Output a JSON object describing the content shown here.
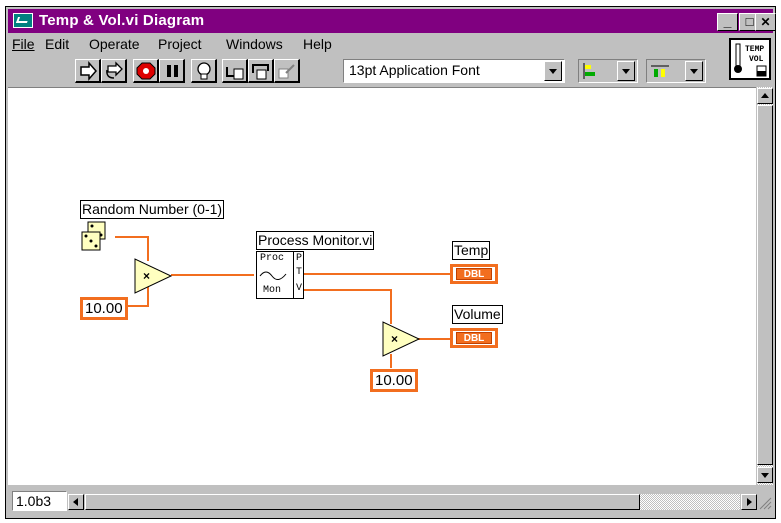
{
  "window": {
    "title": "Temp & Vol.vi Diagram",
    "controls": {
      "minimize": "_",
      "maximize": "□",
      "close": "✕"
    }
  },
  "menu": [
    "File",
    "Edit",
    "Operate",
    "Project",
    "Windows",
    "Help"
  ],
  "toolbar": {
    "buttons": [
      "run-arrow-icon",
      "run-continuous-icon",
      "abort-icon",
      "pause-icon",
      "highlight-execution-icon",
      "step-into-icon",
      "step-over-icon",
      "step-out-icon"
    ],
    "font_selector": "13pt Application Font",
    "align_icon": "align-objects-icon",
    "distribute_icon": "distribute-objects-icon"
  },
  "vi_icon": {
    "line1": "TEMP",
    "line2": "VOL"
  },
  "diagram": {
    "random_label": "Random Number (0-1)",
    "constant_1": "10.00",
    "constant_2": "10.00",
    "subvi_label": "Process Monitor.vi",
    "subvi_top": "Proc",
    "subvi_bottom": "Mon",
    "subvi_terminals": [
      "P",
      "T",
      "V"
    ],
    "temp_label": "Temp",
    "volume_label": "Volume",
    "indicator_type": "DBL",
    "multiply_symbol": "×",
    "wire_color": "#f26e1f"
  },
  "status": {
    "version": "1.0b3"
  }
}
